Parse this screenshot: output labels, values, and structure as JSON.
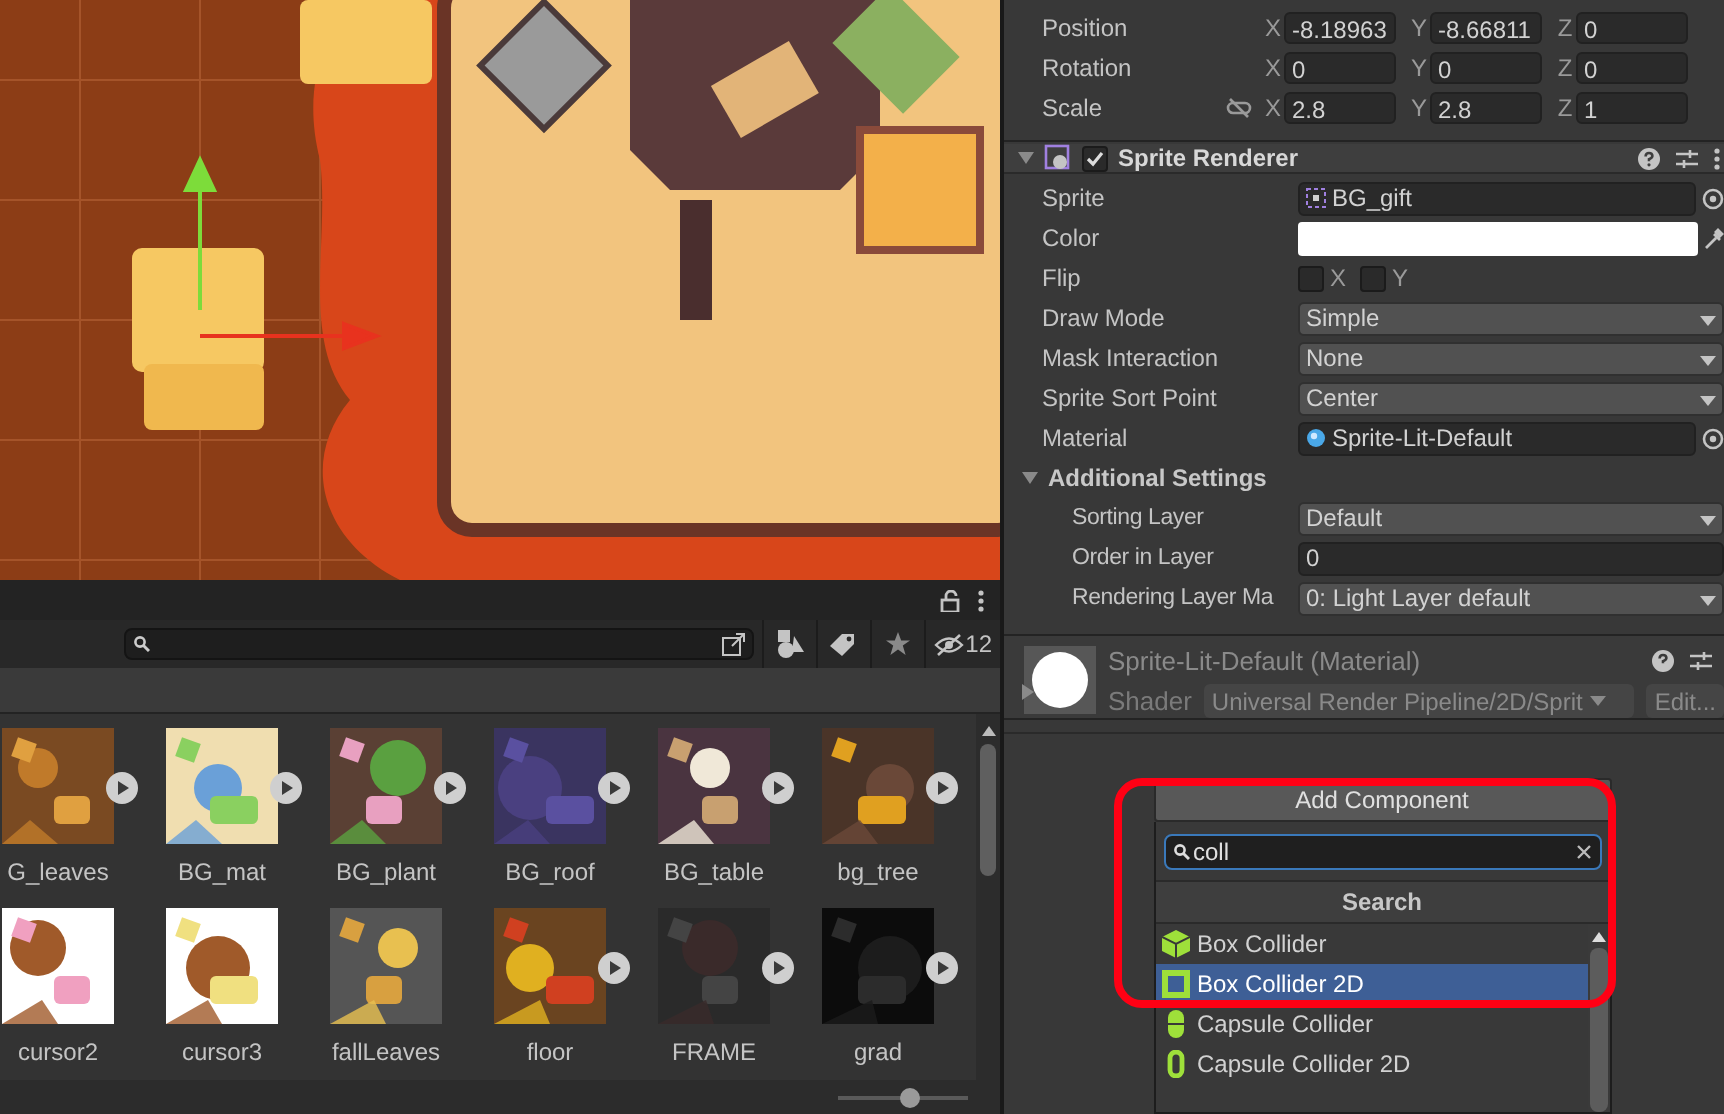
{
  "project": {
    "hidden_count": "12",
    "zoom_slider": {
      "level": 0.56
    },
    "assets": [
      {
        "name": "G_leaves",
        "expandable": true
      },
      {
        "name": "BG_mat",
        "expandable": true
      },
      {
        "name": "BG_plant",
        "expandable": true
      },
      {
        "name": "BG_roof",
        "expandable": true
      },
      {
        "name": "BG_table",
        "expandable": true
      },
      {
        "name": "bg_tree",
        "expandable": true
      },
      {
        "name": "cursor2",
        "expandable": false
      },
      {
        "name": "cursor3",
        "expandable": false
      },
      {
        "name": "fallLeaves",
        "expandable": false
      },
      {
        "name": "floor",
        "expandable": true
      },
      {
        "name": "FRAME",
        "expandable": true
      },
      {
        "name": "grad",
        "expandable": true
      }
    ]
  },
  "inspector": {
    "transform": [
      {
        "label": "Position",
        "fields": [
          {
            "axis": "X",
            "value": "-8.18963"
          },
          {
            "axis": "Y",
            "value": "-8.66811"
          },
          {
            "axis": "Z",
            "value": "0"
          }
        ]
      },
      {
        "label": "Rotation",
        "fields": [
          {
            "axis": "X",
            "value": "0"
          },
          {
            "axis": "Y",
            "value": "0"
          },
          {
            "axis": "Z",
            "value": "0"
          }
        ]
      },
      {
        "label": "Scale",
        "constrain_proportions": false,
        "fields": [
          {
            "axis": "X",
            "value": "2.8"
          },
          {
            "axis": "Y",
            "value": "2.8"
          },
          {
            "axis": "Z",
            "value": "1"
          }
        ]
      }
    ],
    "sprite_renderer": {
      "title": "Sprite Renderer",
      "expanded": true,
      "enabled": true,
      "properties": [
        {
          "kind": "sprite",
          "label": "Sprite",
          "value": "BG_gift"
        },
        {
          "kind": "color",
          "label": "Color",
          "color": "#ffffff"
        },
        {
          "kind": "toggles",
          "label": "Flip",
          "toggles": [
            {
              "label": "X",
              "checked": false
            },
            {
              "label": "Y",
              "checked": false
            }
          ]
        },
        {
          "kind": "dropdown",
          "label": "Draw Mode",
          "value": "Simple"
        },
        {
          "kind": "dropdown",
          "label": "Mask Interaction",
          "value": "None"
        },
        {
          "kind": "dropdown",
          "label": "Sprite Sort Point",
          "value": "Center"
        },
        {
          "kind": "material",
          "label": "Material",
          "value": "Sprite-Lit-Default"
        }
      ],
      "additional_settings": {
        "title": "Additional Settings",
        "expanded": true,
        "properties": [
          {
            "kind": "dropdown",
            "label": "Sorting Layer",
            "value": "Default"
          },
          {
            "kind": "number",
            "label": "Order in Layer",
            "value": "0"
          },
          {
            "kind": "dropdown",
            "label": "Rendering Layer Ma",
            "value": "0: Light Layer default"
          }
        ]
      }
    },
    "material": {
      "title": "Sprite-Lit-Default (Material)",
      "expanded": false,
      "shader_label": "Shader",
      "shader": "Universal Render Pipeline/2D/Sprit",
      "edit_button": "Edit..."
    },
    "add_component": {
      "button": "Add Component",
      "search": {
        "value": "coll"
      },
      "header": "Search",
      "results": [
        {
          "name": "Box Collider",
          "kind": "cube",
          "selected": false
        },
        {
          "name": "Box Collider 2D",
          "kind": "square",
          "selected": true
        },
        {
          "name": "Capsule Collider",
          "kind": "capsule",
          "selected": false
        },
        {
          "name": "Capsule Collider 2D",
          "kind": "capsule2d",
          "selected": false
        }
      ]
    }
  }
}
